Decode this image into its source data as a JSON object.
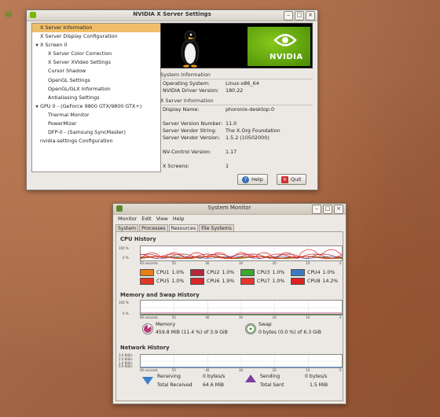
{
  "desktop": {},
  "nvidia": {
    "title": "NVIDIA X Server Settings",
    "tree": [
      {
        "label": "X Server Information",
        "indent": 1,
        "selected": true,
        "arrow": ""
      },
      {
        "label": "X Server Display Configuration",
        "indent": 1,
        "selected": false,
        "arrow": ""
      },
      {
        "label": "X Screen 0",
        "indent": 0,
        "selected": false,
        "arrow": "▼"
      },
      {
        "label": "X Server Color Correction",
        "indent": 2,
        "selected": false,
        "arrow": ""
      },
      {
        "label": "X Server XVideo Settings",
        "indent": 2,
        "selected": false,
        "arrow": ""
      },
      {
        "label": "Cursor Shadow",
        "indent": 2,
        "selected": false,
        "arrow": ""
      },
      {
        "label": "OpenGL Settings",
        "indent": 2,
        "selected": false,
        "arrow": ""
      },
      {
        "label": "OpenGL/GLX Information",
        "indent": 2,
        "selected": false,
        "arrow": ""
      },
      {
        "label": "Antialiasing Settings",
        "indent": 2,
        "selected": false,
        "arrow": ""
      },
      {
        "label": "GPU 0 - (GeForce 9800 GTX/9800 GTX+)",
        "indent": 0,
        "selected": false,
        "arrow": "▼"
      },
      {
        "label": "Thermal Monitor",
        "indent": 2,
        "selected": false,
        "arrow": ""
      },
      {
        "label": "PowerMizer",
        "indent": 2,
        "selected": false,
        "arrow": ""
      },
      {
        "label": "DFP-0 - (Samsung SyncMaster)",
        "indent": 2,
        "selected": false,
        "arrow": ""
      },
      {
        "label": "nvidia-settings Configuration",
        "indent": 1,
        "selected": false,
        "arrow": ""
      }
    ],
    "banner_logo": "NVIDIA",
    "system_section": "System Information",
    "system": [
      {
        "k": "Operating System:",
        "v": "Linux-x86_64"
      },
      {
        "k": "NVIDIA Driver Version:",
        "v": "180.22"
      }
    ],
    "xserver_section": "X Server Information",
    "xserver": [
      {
        "k": "Display Name:",
        "v": "phoronix-desktop:0"
      },
      {
        "k": "",
        "v": ""
      },
      {
        "k": "Server Version Number:",
        "v": "11.0"
      },
      {
        "k": "Server Vendor String:",
        "v": "The X.Org Foundation"
      },
      {
        "k": "Server Vendor Version:",
        "v": "1.5.2 (10502000)"
      },
      {
        "k": "",
        "v": ""
      },
      {
        "k": "NV-Control Version:",
        "v": "1.17"
      },
      {
        "k": "",
        "v": ""
      },
      {
        "k": "X Screens:",
        "v": "1"
      }
    ],
    "help_label": "Help",
    "quit_label": "Quit"
  },
  "sysmon": {
    "title": "System Monitor",
    "menu": [
      "Monitor",
      "Edit",
      "View",
      "Help"
    ],
    "tabs": [
      "System",
      "Processes",
      "Resources",
      "File Systems"
    ],
    "active_tab": 2,
    "cpu_heading": "CPU History",
    "cpu_axis": [
      "100 %",
      "0 %"
    ],
    "x_ticks": [
      "60 seconds",
      "50",
      "40",
      "30",
      "20",
      "10",
      "0"
    ],
    "cpus": [
      {
        "label": "CPU1",
        "value": "1.0%",
        "color": "#e87f14"
      },
      {
        "label": "CPU2",
        "value": "1.0%",
        "color": "#b3293c"
      },
      {
        "label": "CPU3",
        "value": "1.0%",
        "color": "#3aa828"
      },
      {
        "label": "CPU4",
        "value": "1.0%",
        "color": "#3c78c0"
      },
      {
        "label": "CPU5",
        "value": "1.0%",
        "color": "#e03624"
      },
      {
        "label": "CPU6",
        "value": "1.9%",
        "color": "#d8262a"
      },
      {
        "label": "CPU7",
        "value": "1.0%",
        "color": "#e8352c"
      },
      {
        "label": "CPU8",
        "value": "14.2%",
        "color": "#e02020"
      }
    ],
    "mem_heading": "Memory and Swap History",
    "mem_axis": [
      "100 %",
      "0 %"
    ],
    "memory_label": "Memory",
    "memory_value": "459.8 MiB (11.4 %) of 3.9 GiB",
    "memory_fraction": 0.114,
    "swap_label": "Swap",
    "swap_value": "0 bytes (0.0 %) of 6.3 GiB",
    "swap_fraction": 0.0,
    "net_heading": "Network History",
    "net_axis": [
      "3.0 KiB/s",
      "2.0 KiB/s",
      "1.0 KiB/s",
      "0.0 KiB/s"
    ],
    "receiving_label": "Receiving",
    "receiving_value": "0 bytes/s",
    "total_received_label": "Total Received",
    "total_received_value": "64.6 MiB",
    "sending_label": "Sending",
    "sending_value": "0 bytes/s",
    "total_sent_label": "Total Sent",
    "total_sent_value": "1.5 MiB"
  }
}
